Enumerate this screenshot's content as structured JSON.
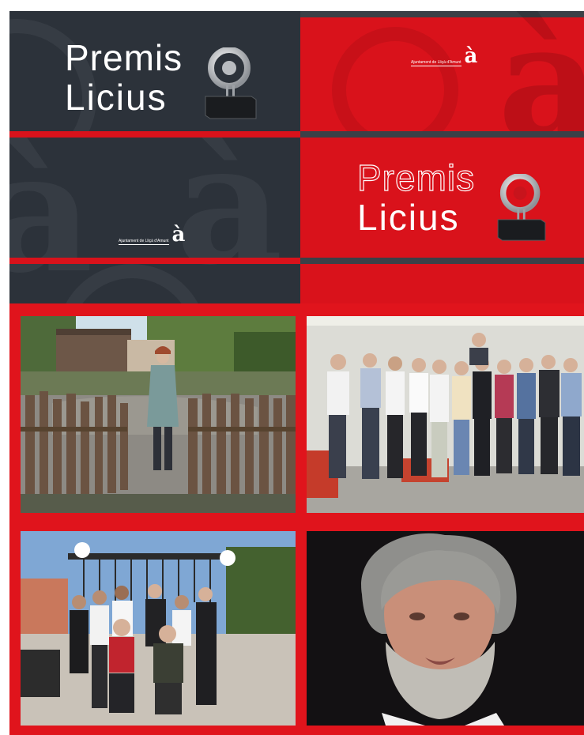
{
  "banner": {
    "title_line1": "Premis",
    "title_line2": "Licius",
    "logo_text": "Ajuntament de Lliçà d'Amunt",
    "logo_mark": "à",
    "watermark_letter": "à",
    "colors": {
      "red": "#d9121b",
      "dark": "#2c323a"
    }
  },
  "photos": [
    {
      "name": "woman-at-wooden-fence"
    },
    {
      "name": "group-photo-indoors"
    },
    {
      "name": "family-group-outdoors"
    },
    {
      "name": "portrait-bearded-man"
    }
  ]
}
